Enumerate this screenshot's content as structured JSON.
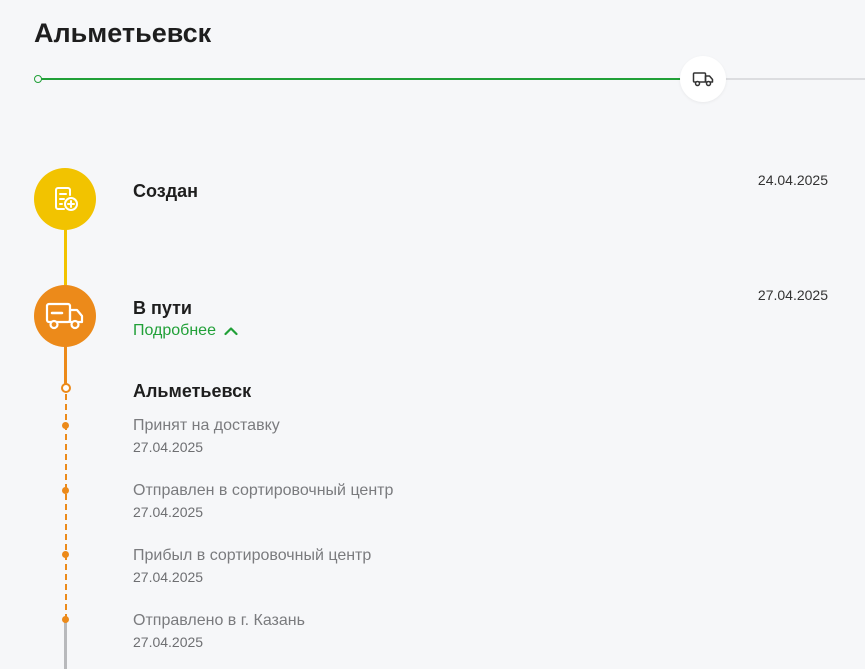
{
  "header": {
    "title": "Альметьевск"
  },
  "progress": {
    "fraction": 0.8,
    "marker_icon": "truck-icon",
    "accent_color": "#21a038"
  },
  "stages": [
    {
      "title": "Создан",
      "date": "24.04.2025",
      "icon": "document-add-icon",
      "color": "#f2c300"
    },
    {
      "title": "В пути",
      "date": "27.04.2025",
      "icon": "truck-icon",
      "color": "#ec8a1a",
      "details_label": "Подробнее"
    }
  ],
  "details": {
    "city": "Альметьевск",
    "events": [
      {
        "title": "Принят на доставку",
        "date": "27.04.2025"
      },
      {
        "title": "Отправлен в сортировочный центр",
        "date": "27.04.2025"
      },
      {
        "title": "Прибыл в сортировочный центр",
        "date": "27.04.2025"
      },
      {
        "title": "Отправлено в г. Казань",
        "date": "27.04.2025"
      }
    ]
  }
}
